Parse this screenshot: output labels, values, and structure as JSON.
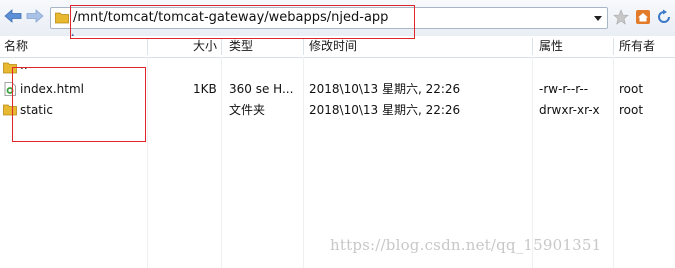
{
  "toolbar": {
    "path": "/mnt/tomcat/tomcat-gateway/webapps/njed-app",
    "back_icon": "arrow-left-icon",
    "forward_icon": "arrow-right-icon",
    "bookmark_icon": "star-icon",
    "home_icon": "home-icon",
    "refresh_icon": "refresh-icon"
  },
  "columns": {
    "name": "名称",
    "size": "大小",
    "type": "类型",
    "modified": "修改时间",
    "attributes": "属性",
    "owner": "所有者"
  },
  "files": [
    {
      "name": "..",
      "size": "",
      "type": "",
      "modified": "",
      "attributes": "",
      "owner": "",
      "icon": "folder-icon"
    },
    {
      "name": "index.html",
      "size": "1KB",
      "type": "360 se H...",
      "modified": "2018\\10\\13 星期六, 22:26",
      "attributes": "-rw-r--r--",
      "owner": "root",
      "icon": "html-file-icon"
    },
    {
      "name": "static",
      "size": "",
      "type": "文件夹",
      "modified": "2018\\10\\13 星期六, 22:26",
      "attributes": "drwxr-xr-x",
      "owner": "root",
      "icon": "folder-icon"
    }
  ],
  "watermark": "https://blog.csdn.net/qq_15901351",
  "colors": {
    "annotation_red": "#e0262b",
    "folder_yellow": "#e8b830",
    "toolbar_blue": "#3c78c8"
  }
}
